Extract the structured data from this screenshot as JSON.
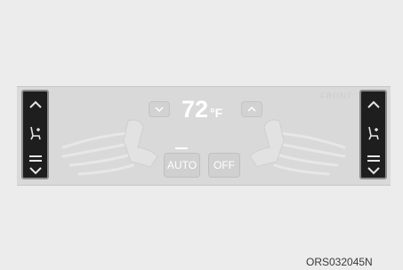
{
  "temperature": {
    "value": "72",
    "unit": "°F"
  },
  "buttons": {
    "auto_label": "AUTO",
    "off_label": "OFF"
  },
  "front_label": "FRONT",
  "image_code": "ORS032045N",
  "colors": {
    "side_panel": "#1e1e1e",
    "panel": "#d9d9d9",
    "display_text": "#ffffff"
  },
  "icons": [
    "chevron-up-icon",
    "seat-heat-icon",
    "menu-bars-icon",
    "chevron-down-icon",
    "seat-icon",
    "airflow-icon"
  ]
}
